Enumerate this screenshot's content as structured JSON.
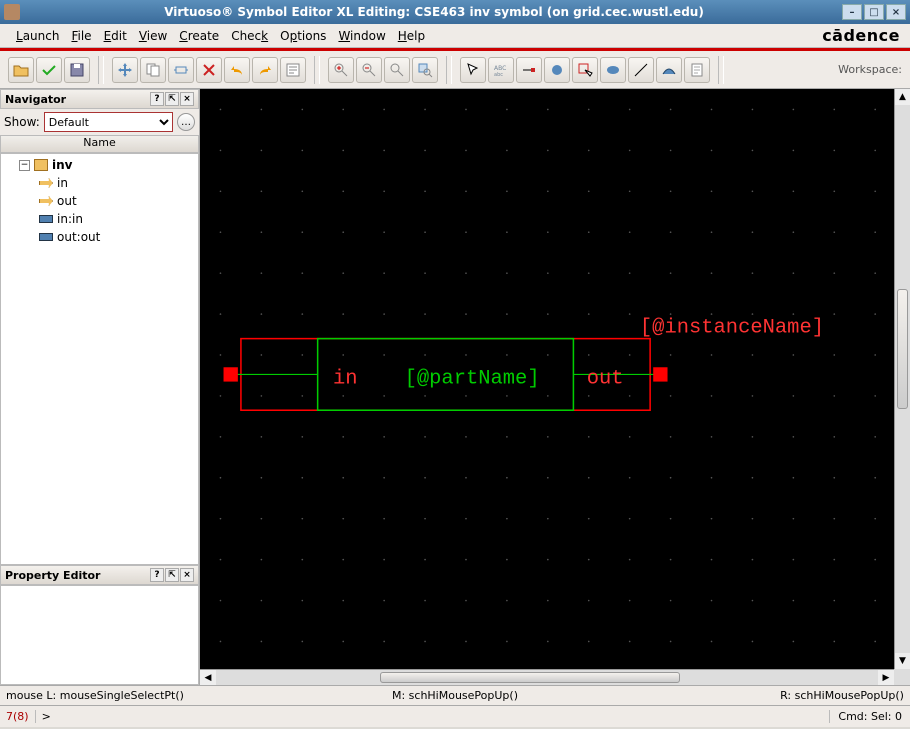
{
  "window": {
    "title": "Virtuoso® Symbol Editor XL Editing: CSE463 inv symbol (on grid.cec.wustl.edu)"
  },
  "menu": {
    "items": [
      "Launch",
      "File",
      "Edit",
      "View",
      "Create",
      "Check",
      "Options",
      "Window",
      "Help"
    ],
    "brand": "cādence"
  },
  "toolbar": {
    "workspace_label": "Workspace:"
  },
  "navigator": {
    "title": "Navigator",
    "show_label": "Show:",
    "show_value": "Default",
    "column": "Name",
    "tree": {
      "root": "inv",
      "pins": [
        "in",
        "out"
      ],
      "terminals": [
        "in:in",
        "out:out"
      ]
    }
  },
  "property_editor": {
    "title": "Property Editor"
  },
  "canvas": {
    "label_in": "in",
    "label_out": "out",
    "part_name": "[@partName]",
    "instance_name": "[@instanceName]"
  },
  "status": {
    "mouse_l": "mouse L: mouseSingleSelectPt()",
    "mouse_m": "M: schHiMousePopUp()",
    "mouse_r": "R: schHiMousePopUp()",
    "count": "7(8)",
    "prompt": ">",
    "cmd": "Cmd: Sel: 0"
  }
}
